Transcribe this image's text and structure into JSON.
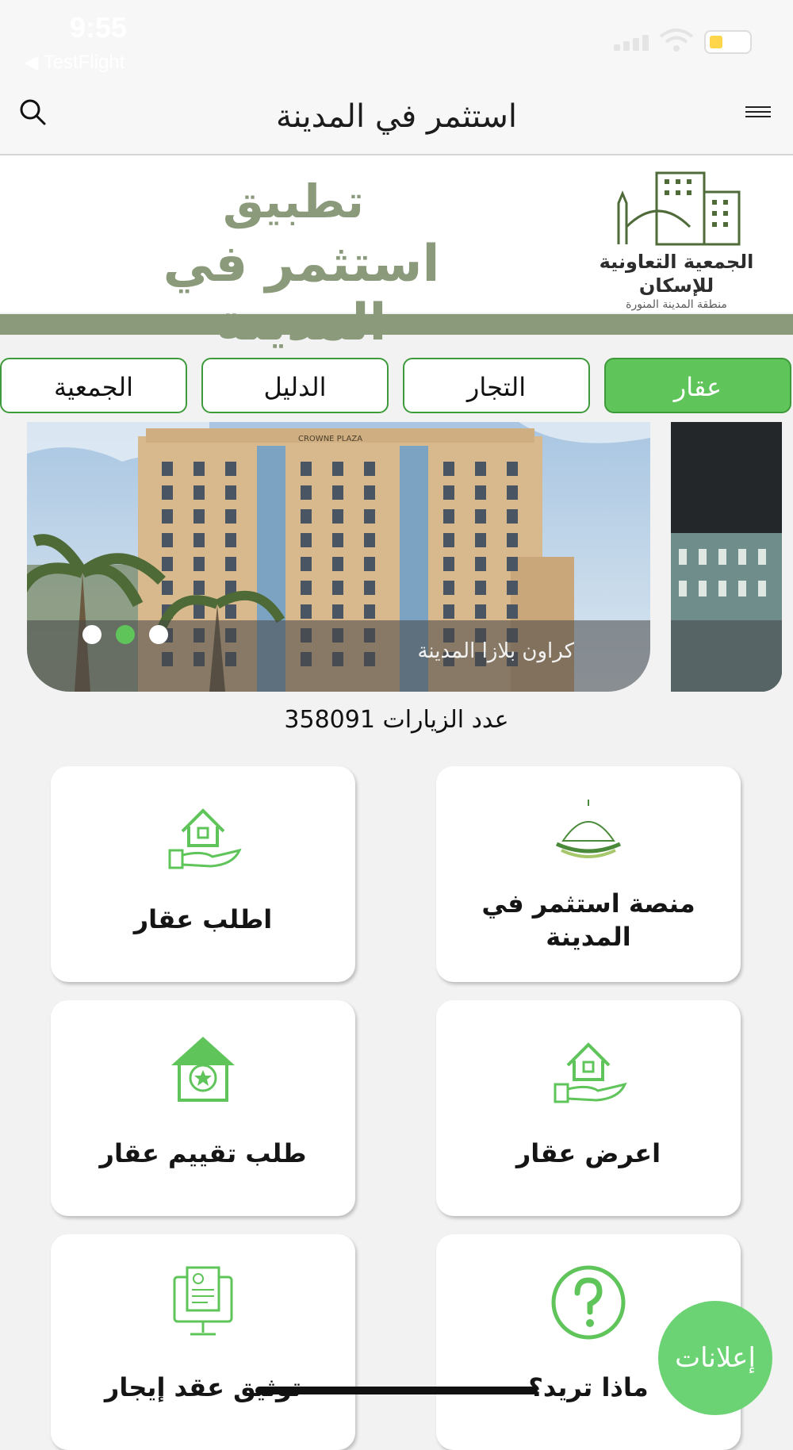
{
  "status_bar": {
    "time": "9:55",
    "back_app": "◀ TestFlight"
  },
  "nav": {
    "title": "استثمر في المدينة",
    "search_icon": "search-icon",
    "menu_icon": "hamburger-menu-icon"
  },
  "banner": {
    "line1": "تطبيق",
    "line2": "استثمر في المدينة",
    "logo_line1": "الجمعية التعاونية",
    "logo_line2": "للإسكان",
    "logo_line3": "منطقة المدينة المنورة",
    "color": "#8a9a7a"
  },
  "tabs": [
    {
      "label": "عقار",
      "active": true
    },
    {
      "label": "التجار",
      "active": false
    },
    {
      "label": "الدليل",
      "active": false
    },
    {
      "label": "الجمعية",
      "active": false
    }
  ],
  "carousel": {
    "caption": "كراون بلازا المدينة",
    "hotel_sign": "CROWNE PLAZA",
    "dots": 3,
    "active_dot": 2
  },
  "visits": {
    "text": "عدد الزيارات 358091"
  },
  "cards": [
    {
      "label": "منصة استثمر في المدينة",
      "icon": "dome-logo-icon"
    },
    {
      "label": "اطلب عقار",
      "icon": "house-hand-icon"
    },
    {
      "label": "اعرض عقار",
      "icon": "house-hand-icon"
    },
    {
      "label": "طلب تقييم عقار",
      "icon": "house-star-icon"
    },
    {
      "label": "ماذا تريد؟",
      "icon": "question-icon"
    },
    {
      "label": "توثيق عقد إيجار",
      "icon": "contract-monitor-icon"
    }
  ],
  "fab": {
    "label": "إعلانات"
  },
  "colors": {
    "accent": "#5fc45a",
    "icon_green": "#5fc45a"
  }
}
